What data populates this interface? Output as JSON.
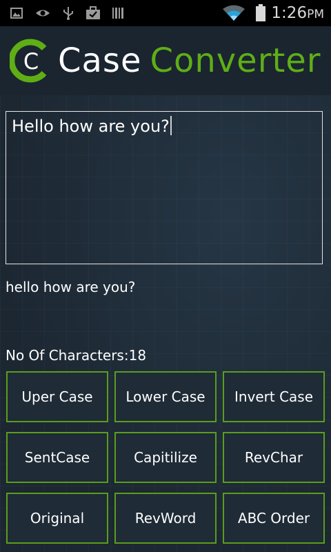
{
  "status_bar": {
    "time": "1:26",
    "ampm": "PM",
    "icons": [
      "image-icon",
      "eye-icon",
      "usb-icon",
      "briefcase-check-icon",
      "barcode-icon",
      "wifi-icon",
      "battery-icon"
    ]
  },
  "header": {
    "logo_letter": "C",
    "title_word1": "Case",
    "title_word2": "Converter"
  },
  "input": {
    "value": "Hello how are you?"
  },
  "output": {
    "text": "hello how are you?"
  },
  "stats": {
    "char_count_text": "No Of Characters:18"
  },
  "buttons": [
    {
      "label": "Uper Case"
    },
    {
      "label": "Lower Case"
    },
    {
      "label": "Invert Case"
    },
    {
      "label": "SentCase"
    },
    {
      "label": "Capitilize"
    },
    {
      "label": "RevChar"
    },
    {
      "label": "Original"
    },
    {
      "label": "RevWord"
    },
    {
      "label": "ABC Order"
    }
  ],
  "colors": {
    "accent": "#5fae16",
    "button_border": "#5a9e1c",
    "background": "#1e2a35"
  }
}
